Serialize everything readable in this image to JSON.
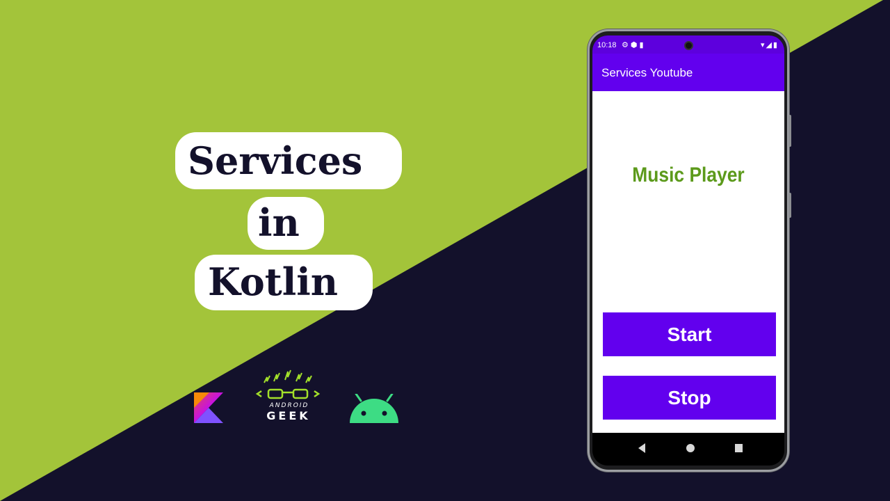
{
  "title_lines": [
    "Services",
    "in",
    "Kotlin"
  ],
  "logos": {
    "kotlin": "kotlin-logo",
    "geek_top": "ANDROID",
    "geek_bottom": "GEEK",
    "android": "android-robot-logo"
  },
  "phone": {
    "status_bar": {
      "time": "10:18",
      "left_icons": "⚙⬢▮",
      "right_icons": "▾◢▮"
    },
    "app_bar": {
      "title": "Services Youtube"
    },
    "main": {
      "heading": "Music Player",
      "start_label": "Start",
      "stop_label": "Stop"
    }
  },
  "colors": {
    "green_bg": "#a3c43a",
    "navy_bg": "#13112b",
    "primary": "#6200ee",
    "status": "#5d00dd",
    "heading": "#5c9a1b"
  }
}
